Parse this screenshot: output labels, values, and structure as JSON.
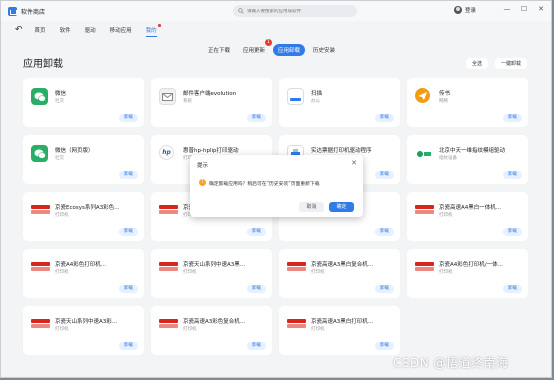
{
  "app": {
    "title": "软件商店"
  },
  "search": {
    "placeholder": "请输入要搜索的应用或软件"
  },
  "user": {
    "login": "登录"
  },
  "window": {
    "minimize": "—",
    "maximize": "☐",
    "close": "✕"
  },
  "nav": {
    "back": "↶",
    "items": [
      {
        "label": "首页"
      },
      {
        "label": "软件"
      },
      {
        "label": "驱动"
      },
      {
        "label": "移动应用"
      },
      {
        "label": "我的"
      }
    ]
  },
  "subtabs": [
    {
      "label": "正在下载"
    },
    {
      "label": "应用更新",
      "badge": "1"
    },
    {
      "label": "应用卸载"
    },
    {
      "label": "历史安装"
    }
  ],
  "page": {
    "title": "应用卸载",
    "select_all": "全选",
    "batch_uninstall": "一键卸载"
  },
  "apps": [
    {
      "name": "微信",
      "category": "社交",
      "icon": "wechat-icon",
      "action": "卸载"
    },
    {
      "name": "邮件客户端evolution",
      "category": "系统",
      "icon": "mail-icon",
      "action": "卸载"
    },
    {
      "name": "扫描",
      "category": "办公",
      "icon": "scanner-icon",
      "action": "卸载"
    },
    {
      "name": "传书",
      "category": "网络",
      "icon": "paper-plane-icon",
      "action": "卸载"
    },
    {
      "name": "微信（网页版）",
      "category": "社交",
      "icon": "wechat-icon",
      "action": "卸载"
    },
    {
      "name": "惠普hp-hplip打印驱动",
      "category": "打印机",
      "icon": "hp-icon",
      "action": "卸载"
    },
    {
      "name": "实达票据打印机驱动程序",
      "category": "打印机",
      "icon": "printer-icon",
      "action": "卸载"
    },
    {
      "name": "北京中天一维指纹模组驱动",
      "category": "指纹设备",
      "icon": "fingerprint-icon",
      "action": "卸载"
    },
    {
      "name": "京瓷Ecosys系列A3彩色...",
      "category": "打印机",
      "icon": "kyocera-icon",
      "action": "卸载"
    },
    {
      "name": "京瓷高速A3...",
      "category": "打印机",
      "icon": "kyocera-icon",
      "action": "卸载"
    },
    {
      "name": "京瓷高速A3...",
      "category": "打印机",
      "icon": "kyocera-icon",
      "action": "卸载"
    },
    {
      "name": "京瓷高速A4黑白一体机...",
      "category": "打印机",
      "icon": "kyocera-icon",
      "action": "卸载"
    },
    {
      "name": "京瓷A4彩色打印机...",
      "category": "打印机",
      "icon": "kyocera-icon",
      "action": "卸载"
    },
    {
      "name": "京瓷天山系列中速A3黑...",
      "category": "打印机",
      "icon": "kyocera-icon",
      "action": "卸载"
    },
    {
      "name": "京瓷高速A3黑白复合机...",
      "category": "打印机",
      "icon": "kyocera-icon",
      "action": "卸载"
    },
    {
      "name": "京瓷A4彩色打印机/一体...",
      "category": "打印机",
      "icon": "kyocera-icon",
      "action": "卸载"
    },
    {
      "name": "京瓷天山系列中速A3彩...",
      "category": "打印机",
      "icon": "kyocera-icon",
      "action": "卸载"
    },
    {
      "name": "京瓷高速A3彩色复合机...",
      "category": "打印机",
      "icon": "kyocera-icon",
      "action": "卸载"
    },
    {
      "name": "京瓷高速A3黑白打印机...",
      "category": "打印机",
      "icon": "kyocera-icon",
      "action": "卸载"
    }
  ],
  "dialog": {
    "title": "提示",
    "close": "✕",
    "icon": "!",
    "message": "确定卸载应用吗？稍后可在“历史安装”页面重新下载",
    "cancel": "取消",
    "confirm": "确定"
  },
  "watermark": "CSDN @悟道终南海",
  "colors": {
    "accent": "#2f7be8",
    "badge": "#e53935",
    "kyocera": "#d9261c",
    "wechat": "#2aae67"
  }
}
